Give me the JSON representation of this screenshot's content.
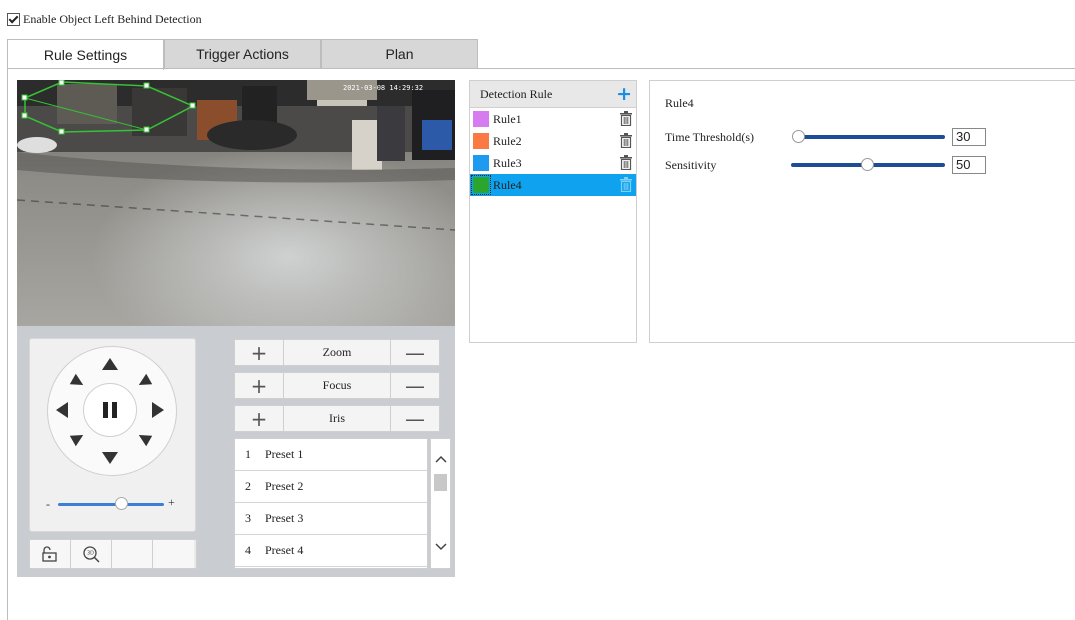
{
  "enable": {
    "label": "Enable Object Left Behind Detection",
    "checked": true
  },
  "tabs": [
    {
      "label": "Rule Settings",
      "active": true
    },
    {
      "label": "Trigger Actions",
      "active": false
    },
    {
      "label": "Plan",
      "active": false
    }
  ],
  "video": {
    "timestamp": "2021-03-08 14:29:32"
  },
  "ptz": {
    "speed_minus": "-",
    "speed_plus": "+",
    "speed_level": 0.6,
    "zoom": {
      "plus": "+",
      "label": "Zoom",
      "minus": "—"
    },
    "focus": {
      "plus": "+",
      "label": "Focus",
      "minus": "—"
    },
    "iris": {
      "plus": "+",
      "label": "Iris",
      "minus": "—"
    },
    "tools": [
      "lock-icon",
      "zoom-3d-icon",
      "",
      ""
    ]
  },
  "presets": [
    {
      "num": "1",
      "name": "Preset 1"
    },
    {
      "num": "2",
      "name": "Preset 2"
    },
    {
      "num": "3",
      "name": "Preset 3"
    },
    {
      "num": "4",
      "name": "Preset 4"
    }
  ],
  "detection": {
    "header": "Detection Rule",
    "add_icon": "plus-icon",
    "rules": [
      {
        "name": "Rule1",
        "color": "#d77cf0",
        "selected": false
      },
      {
        "name": "Rule2",
        "color": "#fb7a43",
        "selected": false
      },
      {
        "name": "Rule3",
        "color": "#1e9af0",
        "selected": false
      },
      {
        "name": "Rule4",
        "color": "#2ca52c",
        "selected": true
      }
    ]
  },
  "settings": {
    "rule_title": "Rule4",
    "time_threshold": {
      "label": "Time Threshold(s)",
      "value": "30"
    },
    "sensitivity": {
      "label": "Sensitivity",
      "value": "50"
    }
  },
  "colors": {
    "accent": "#0ea2ef",
    "slider": "#1d4c99",
    "tab_inactive": "#d7d7d7"
  }
}
